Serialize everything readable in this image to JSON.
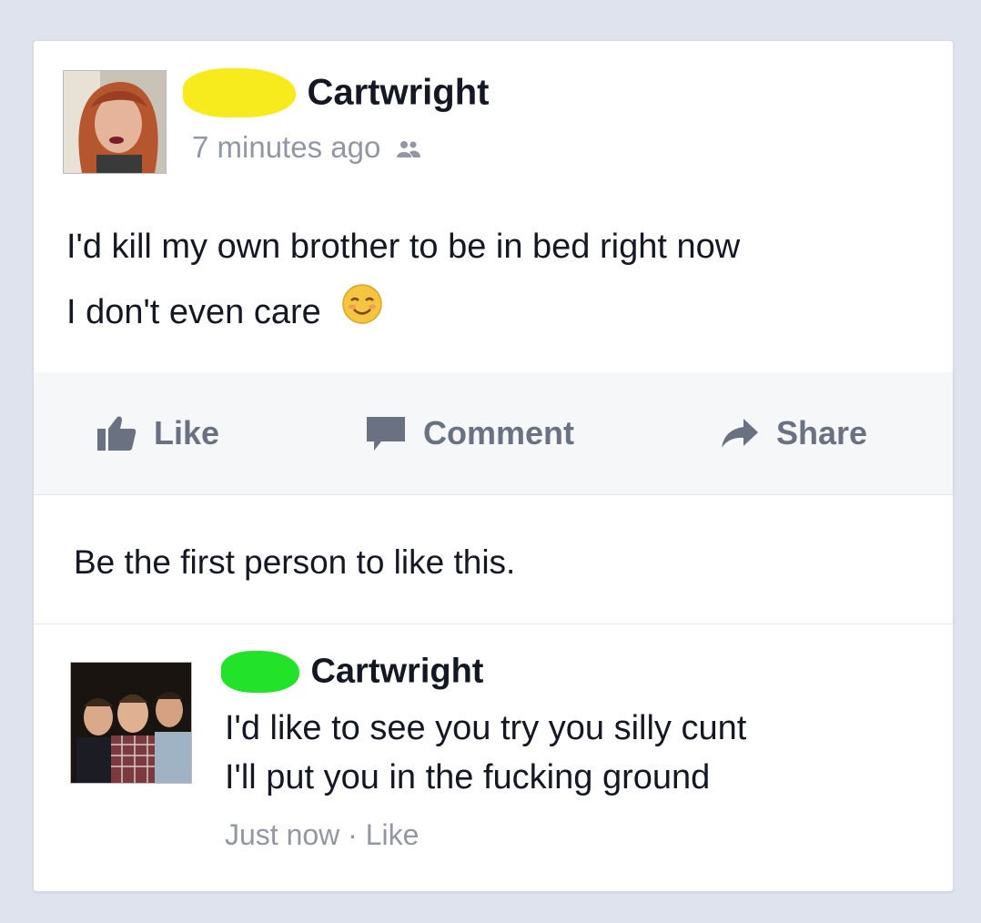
{
  "post": {
    "author_surname": "Cartwright",
    "timestamp": "7 minutes ago",
    "audience_icon": "friends-icon",
    "line1": "I'd kill my own brother to be in bed right now",
    "line2": "I don't even care",
    "emoji": "smiling-face-emoji",
    "redaction_color": "#f7ea1d"
  },
  "actions": {
    "like_label": "Like",
    "comment_label": "Comment",
    "share_label": "Share"
  },
  "likes_line": "Be the first person to like this.",
  "comment": {
    "author_surname": "Cartwright",
    "line1": "I'd like to see you try you silly cunt",
    "line2": "I'll put you in the fucking ground",
    "time": "Just now",
    "separator": "·",
    "like_label": "Like",
    "redaction_color": "#22e22a"
  },
  "colors": {
    "page_bg": "#dfe3ee",
    "card_bg": "#ffffff",
    "muted_text": "#9197a3",
    "action_text": "#6a7180"
  }
}
